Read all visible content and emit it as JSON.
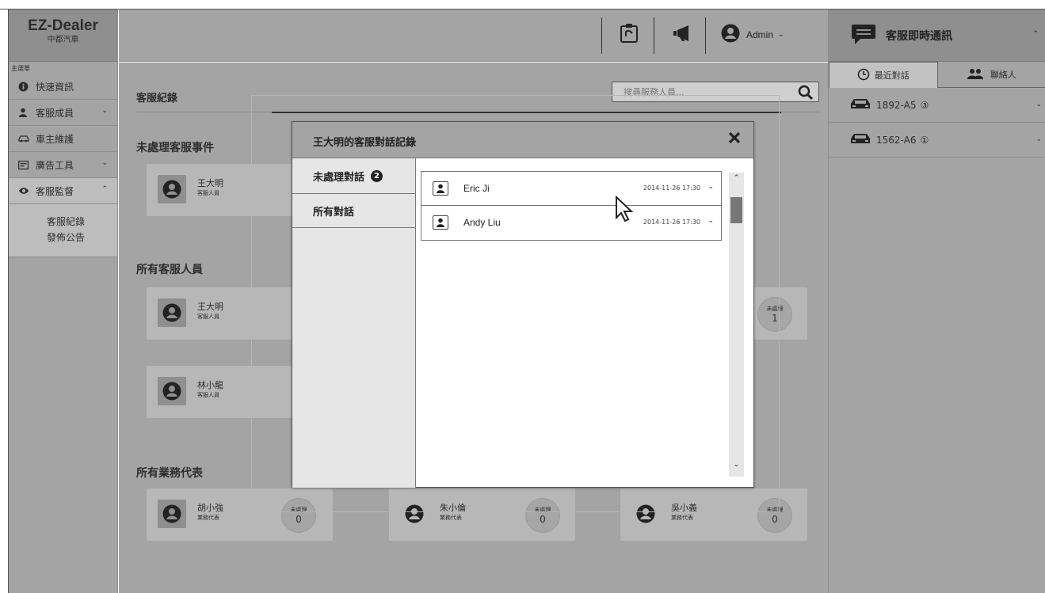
{
  "logo": {
    "brand": "EZ-Dealer",
    "sub": "中都汽車"
  },
  "sidebar": {
    "menu_heading": "主選單",
    "items": [
      {
        "label": "快速資訊",
        "icon": "info-icon"
      },
      {
        "label": "客服成員",
        "icon": "user-icon",
        "chevron": "⌄"
      },
      {
        "label": "車主維護",
        "icon": "car-icon"
      },
      {
        "label": "廣告工具",
        "icon": "ad-icon",
        "chevron": "⌄"
      },
      {
        "label": "客服監督",
        "icon": "eye-icon",
        "chevron": "⌃"
      }
    ],
    "subitems": [
      "客服紀錄",
      "發佈公告"
    ]
  },
  "header": {
    "admin_label": "Admin",
    "admin_chevron": "⌄"
  },
  "main": {
    "page_title": "客服紀錄",
    "search_placeholder": "搜尋服務人員...",
    "sections": {
      "unhandled": "未處理客服事件",
      "all_staff": "所有客服人員",
      "all_reps": "所有業務代表"
    },
    "unhandled_cards": [
      {
        "name": "王大明",
        "role": "客服人員"
      }
    ],
    "staff_cards": [
      {
        "name": "王大明",
        "role": "客服人員"
      },
      {
        "name": "林小龍",
        "role": "客服人員"
      }
    ],
    "staff_right_badge": {
      "label": "未處理",
      "value": "1"
    },
    "rep_cards": [
      {
        "name": "胡小強",
        "role": "業務代表",
        "badge_label": "未處理",
        "badge_value": "0"
      },
      {
        "name": "朱小倫",
        "role": "業務代表",
        "badge_label": "未處理",
        "badge_value": "0"
      },
      {
        "name": "吳小義",
        "role": "業務代表",
        "badge_label": "未處理",
        "badge_value": "0"
      }
    ]
  },
  "right_panel": {
    "title": "客服即時通訊",
    "collapse_chevron": "⌃",
    "tabs": [
      {
        "label": "最近對話",
        "icon": "clock-icon"
      },
      {
        "label": "聯絡人",
        "icon": "group-icon"
      }
    ],
    "rows": [
      {
        "plate": "1892-A5",
        "count": "③",
        "chevron": "⌄"
      },
      {
        "plate": "1562-A6",
        "count": "①",
        "chevron": "⌄"
      }
    ]
  },
  "modal": {
    "title": "王大明的客服對話記錄",
    "close": "close-icon",
    "tabs": [
      {
        "label": "未處理對話",
        "badge": "2"
      },
      {
        "label": "所有對話"
      }
    ],
    "conversations": [
      {
        "user": "Eric Ji",
        "time": "2014-11-26 17:30",
        "chevron": "⌄"
      },
      {
        "user": "Andy Liu",
        "time": "2014-11-26 17:30",
        "chevron": "⌄"
      }
    ],
    "scroll_up": "⌃",
    "scroll_down": "⌄"
  }
}
